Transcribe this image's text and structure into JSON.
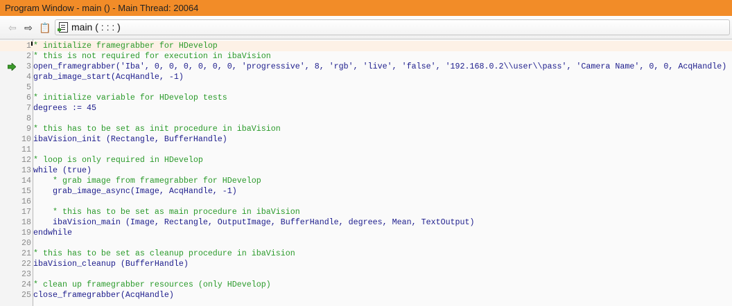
{
  "window": {
    "title": "Program Window - main () - Main Thread: 20064"
  },
  "toolbar": {
    "procedure": "main ( : : : )"
  },
  "editor": {
    "current_line": 1,
    "execution_line": 3,
    "colors": {
      "comment": "#2a9a2a",
      "code": "#1c1c8c",
      "title_bar": "#f28c28"
    },
    "lines": [
      {
        "n": "1",
        "text": "* initialize framegrabber for HDevelop",
        "type": "comment"
      },
      {
        "n": "2",
        "text": "* this is not required for execution in ibaVision",
        "type": "comment"
      },
      {
        "n": "3",
        "text": "open_framegrabber('Iba', 0, 0, 0, 0, 0, 0, 'progressive', 8, 'rgb', 'live', 'false', '192.168.0.2\\\\user\\\\pass', 'Camera Name', 0, 0, AcqHandle)",
        "type": "code"
      },
      {
        "n": "4",
        "text": "grab_image_start(AcqHandle, -1)",
        "type": "code"
      },
      {
        "n": "5",
        "text": "",
        "type": "code"
      },
      {
        "n": "6",
        "text": "* initialize variable for HDevelop tests",
        "type": "comment"
      },
      {
        "n": "7",
        "text": "degrees := 45",
        "type": "code"
      },
      {
        "n": "8",
        "text": "",
        "type": "code"
      },
      {
        "n": "9",
        "text": "* this has to be set as init procedure in ibaVision",
        "type": "comment"
      },
      {
        "n": "10",
        "text": "ibaVision_init (Rectangle, BufferHandle)",
        "type": "code"
      },
      {
        "n": "11",
        "text": "",
        "type": "code"
      },
      {
        "n": "12",
        "text": "* loop is only required in HDevelop",
        "type": "comment"
      },
      {
        "n": "13",
        "text": "while (true)",
        "type": "code"
      },
      {
        "n": "14",
        "text": "    * grab image from framegrabber for HDevelop",
        "type": "comment"
      },
      {
        "n": "15",
        "text": "    grab_image_async(Image, AcqHandle, -1)",
        "type": "code"
      },
      {
        "n": "16",
        "text": "",
        "type": "code"
      },
      {
        "n": "17",
        "text": "    * this has to be set as main procedure in ibaVision",
        "type": "comment"
      },
      {
        "n": "18",
        "text": "    ibaVision_main (Image, Rectangle, OutputImage, BufferHandle, degrees, Mean, TextOutput)",
        "type": "code"
      },
      {
        "n": "19",
        "text": "endwhile",
        "type": "code"
      },
      {
        "n": "20",
        "text": "",
        "type": "code"
      },
      {
        "n": "21",
        "text": "* this has to be set as cleanup procedure in ibaVision",
        "type": "comment"
      },
      {
        "n": "22",
        "text": "ibaVision_cleanup (BufferHandle)",
        "type": "code"
      },
      {
        "n": "23",
        "text": "",
        "type": "code"
      },
      {
        "n": "24",
        "text": "* clean up framegrabber resources (only HDevelop)",
        "type": "comment"
      },
      {
        "n": "25",
        "text": "close_framegrabber(AcqHandle)",
        "type": "code"
      }
    ]
  }
}
